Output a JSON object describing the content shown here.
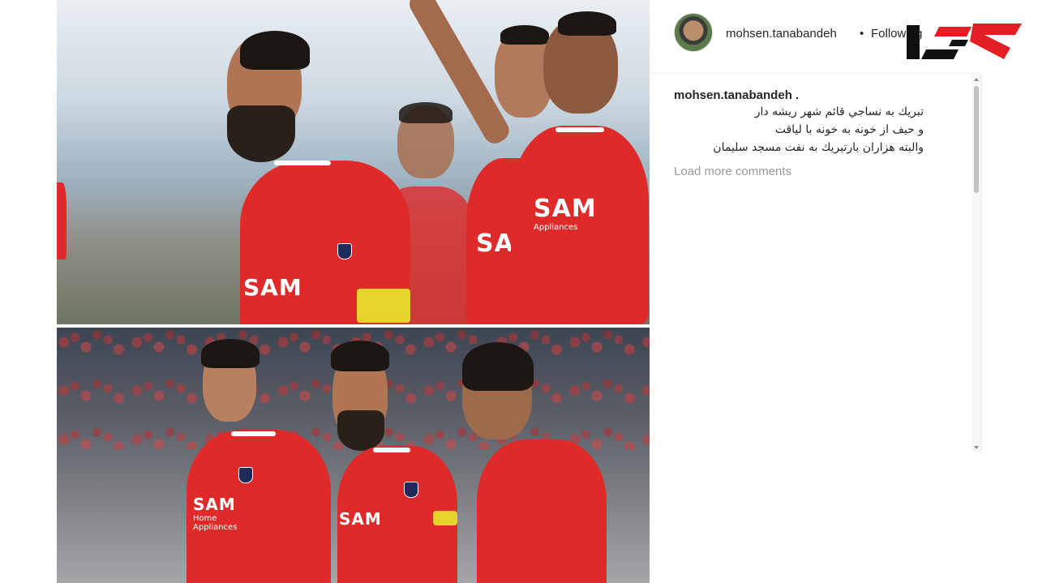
{
  "post": {
    "top_photo_alt": "",
    "bottom_photo_alt": "",
    "sponsor_main": "SAM",
    "sponsor_sub": "Appliances",
    "sponsor_sub_bottom": "Home Appliances"
  },
  "header": {
    "username": "mohsen.tanabandeh",
    "separator": "•",
    "follow_status": "Following"
  },
  "comments": {
    "author": "mohsen.tanabandeh .",
    "lines": [
      "تبريك به نساجي قائم شهر ريشه دار",
      "و حيف از خونه به خونه با لياقت",
      "والبته هزاران بارتبريك به نفت مسجد سليمان"
    ],
    "load_more": "Load more comments"
  },
  "colors": {
    "jersey": "#e02a2a",
    "logo_red": "#e31e24",
    "logo_black": "#111111"
  },
  "icons": {
    "logo": "site-logo",
    "scroll_up": "scroll-up-arrow-icon",
    "scroll_down": "scroll-down-arrow-icon"
  }
}
